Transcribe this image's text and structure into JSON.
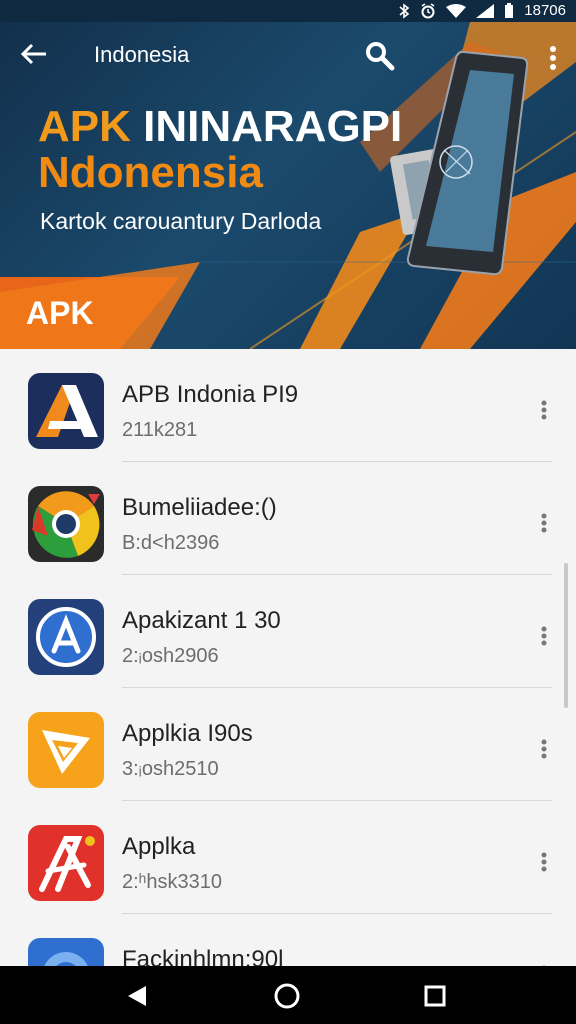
{
  "status_bar": {
    "time": "18706"
  },
  "header": {
    "title": "Indonesia",
    "hero_title_white_part": "I",
    "hero_title_line1_start": "APK ",
    "hero_title_line1_end": "NINARAGPI",
    "hero_title_line2": "Ndonensia",
    "hero_subtitle": "Kartok carouantury Darloda",
    "hero_badge": "APK"
  },
  "colors": {
    "accent": "#f29a1c",
    "header_bg": "#12304c",
    "nav_bg": "#000000"
  },
  "apps": [
    {
      "name": "APB Indonia PI9",
      "meta": "211k281",
      "icon": "a-logo-icon"
    },
    {
      "name": "Bumeliiadee:()",
      "meta": "B:d<h2396",
      "icon": "chrome-like-icon"
    },
    {
      "name": "Apakizant 1  30",
      "meta": "2:ᵢosh2906",
      "icon": "app-store-icon"
    },
    {
      "name": "Applkia I90s",
      "meta": "3:ᵢosh2510",
      "icon": "triangle-play-icon"
    },
    {
      "name": "Applka",
      "meta": "2:ʰhsk3310",
      "icon": "red-a-icon"
    },
    {
      "name": "Fackinhlmn:90l",
      "meta": "",
      "icon": "blue-circle-icon"
    }
  ]
}
